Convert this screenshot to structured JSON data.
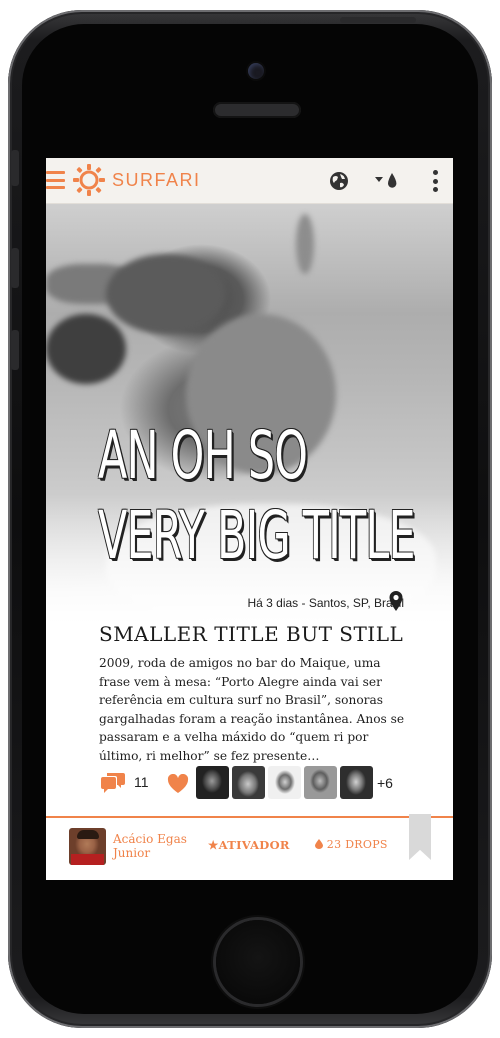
{
  "app": {
    "brand": "SURFARI",
    "colors": {
      "accent": "#f0834a",
      "appbar_bg": "#f4f2ee",
      "text": "#1e1e1e"
    }
  },
  "appbar": {
    "menu_icon": "hamburger-menu-icon",
    "logo_icon": "sun-logo-icon",
    "globe_icon": "globe-icon",
    "drops_filter_icon": "drop-filter-icon",
    "more_icon": "kebab-menu-icon"
  },
  "post": {
    "big_title_line1": "AN OH SO",
    "big_title_line2": "VERY BIG TITLE",
    "meta": "Há 3 dias - Santos, SP, Brasil",
    "subtitle": "SMALLER TITLE BUT STILL",
    "body": "2009, roda de amigos no bar do Maique, uma frase vem à mesa: “Porto Alegre ainda vai ser referência em cultura surf no Brasil”, sonoras gargalhadas foram a reação instantânea. Anos se passaram e a velha máxido do “quem ri por último, ri melhor” se fez presente…",
    "comments": "11",
    "extra_likers": "+6"
  },
  "footer": {
    "user_name_line1": "Acácio Egas",
    "user_name_line2": "Junior",
    "ativador": "ATIVADOR",
    "drops": "23 DROPS"
  }
}
